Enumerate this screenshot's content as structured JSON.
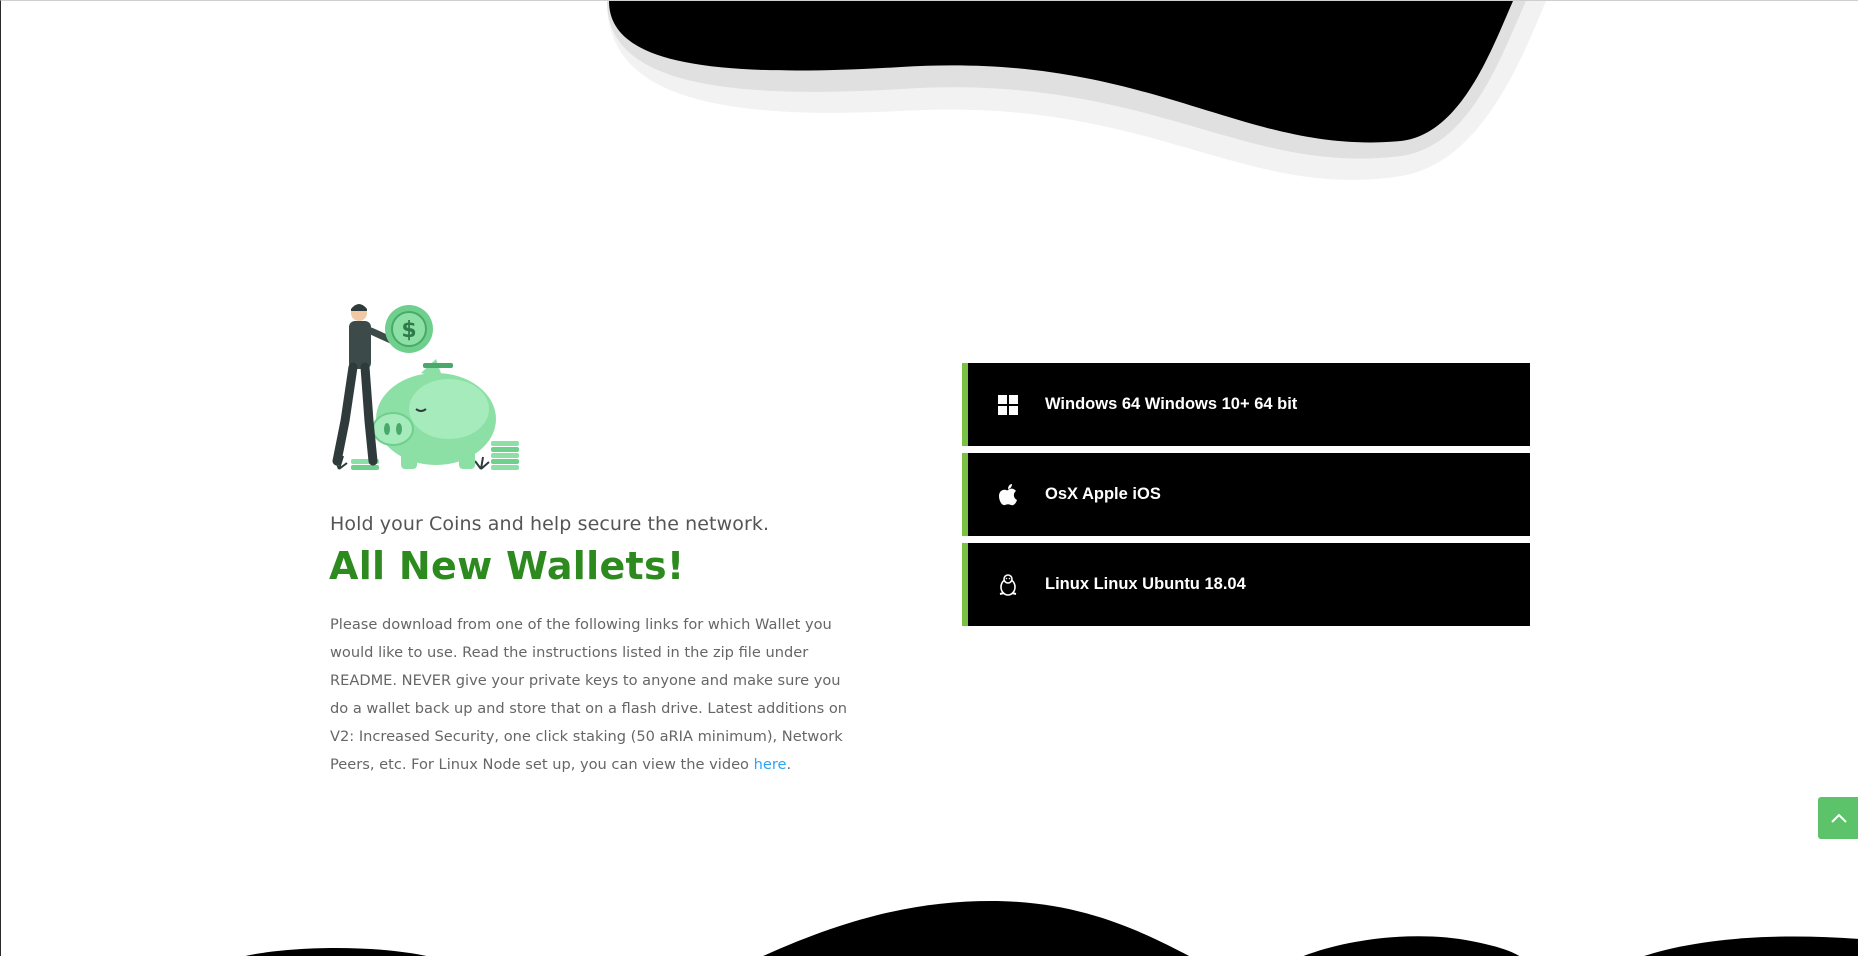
{
  "intro": {
    "kicker": "Hold your Coins and help secure the network.",
    "heading": "All New Wallets!",
    "body": "Please download from one of the following links for which Wallet you would like to use. Read the instructions listed in the zip file under README. NEVER give your private keys to anyone and make sure you do a wallet back up and store that on a flash drive. Latest additions on V2: Increased Security, one click staking (50 aRIA minimum), Network Peers, etc. For Linux Node set up, you can view the video ",
    "link_text": "here",
    "trailing": "."
  },
  "downloads": [
    {
      "icon": "windows-icon",
      "label": "Windows 64 Windows 10+ 64 bit"
    },
    {
      "icon": "apple-icon",
      "label": "OsX Apple iOS"
    },
    {
      "icon": "linux-icon",
      "label": "Linux Linux Ubuntu 18.04"
    }
  ],
  "back_to_top": {
    "icon": "chevron-up-icon"
  },
  "colors": {
    "accent_green": "#2d8a1e",
    "button_border": "#7ac143",
    "button_bg": "#000000",
    "link": "#2ea3f2",
    "back_to_top_bg": "#5cc36b"
  }
}
